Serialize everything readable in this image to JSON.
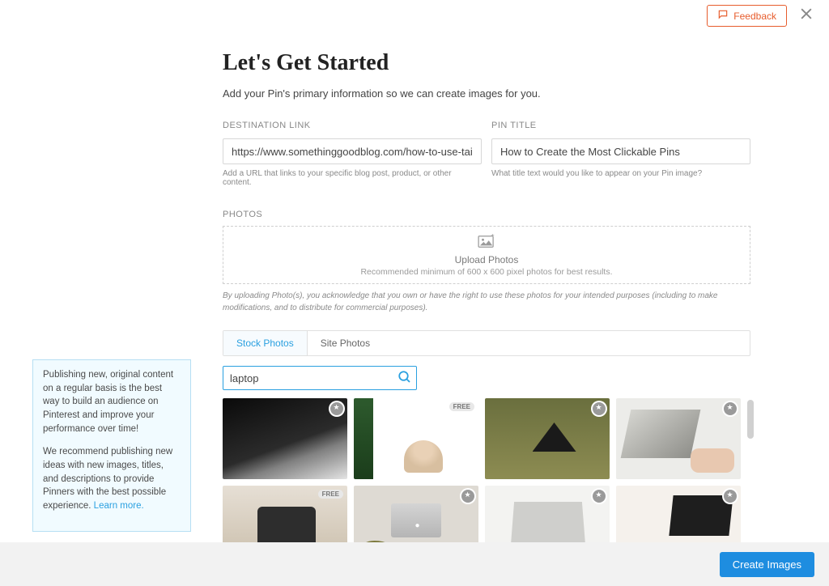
{
  "top": {
    "feedback": "Feedback"
  },
  "header": {
    "title": "Let's Get Started",
    "subtitle": "Add your Pin's primary information so we can create images for you."
  },
  "fields": {
    "destination": {
      "label": "DESTINATION LINK",
      "value": "https://www.somethinggoodblog.com/how-to-use-tailwind-cr",
      "helper": "Add a URL that links to your specific blog post, product, or other content."
    },
    "pintitle": {
      "label": "PIN TITLE",
      "value": "How to Create the Most Clickable Pins",
      "helper": "What title text would you like to appear on your Pin image?"
    }
  },
  "photos": {
    "label": "PHOTOS",
    "upload_title": "Upload Photos",
    "upload_hint": "Recommended minimum of 600 x 600 pixel photos for best results.",
    "disclaimer": "By uploading Photo(s), you acknowledge that you own or have the right to use these photos for your intended purposes (including to make modifications, and to distribute for commercial purposes)."
  },
  "tabs": {
    "stock": "Stock Photos",
    "site": "Site Photos"
  },
  "search": {
    "value": "laptop"
  },
  "badges": {
    "free": "FREE"
  },
  "tip": {
    "p1": "Publishing new, original content on a regular basis is the best way to build an audience on Pinterest and improve your performance over time!",
    "p2": "We recommend publishing new ideas with new images, titles, and descriptions to provide Pinners with the best possible experience.",
    "learn": "Learn more."
  },
  "footer": {
    "create": "Create Images"
  }
}
